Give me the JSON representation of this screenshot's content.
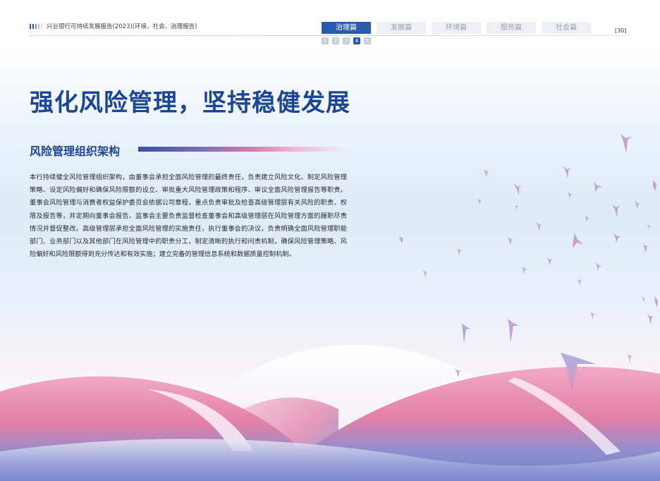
{
  "header": {
    "report_title": "兴业银行可持续发展报告(2023)(环境、社会、治理报告)",
    "bar_colors": [
      "#2a5ba8",
      "#2a5ba8",
      "#7a8cc4",
      "#b7c0dd",
      "#d8dcea"
    ],
    "page_number": "[30]"
  },
  "tabs": [
    {
      "label": "治理篇",
      "active": true
    },
    {
      "label": "发展篇",
      "active": false
    },
    {
      "label": "环境篇",
      "active": false
    },
    {
      "label": "服务篇",
      "active": false
    },
    {
      "label": "社会篇",
      "active": false
    }
  ],
  "steps": [
    {
      "label": "1",
      "active": false
    },
    {
      "label": "2",
      "active": false
    },
    {
      "label": "3",
      "active": false
    },
    {
      "label": "4",
      "active": true
    },
    {
      "label": "5",
      "active": false
    }
  ],
  "main": {
    "title": "强化风险管理，坚持稳健发展",
    "section_heading": "风险管理组织架构",
    "paragraph": "本行持续健全风险管理组织架构，由董事会承担全面风险管理的最终责任，负责建立风险文化、制定风险管理策略、设定风险偏好和确保风险限额的设立、审批重大风险管理政策和程序、审议全面风险管理报告等职责。董事会风险管理与消费者权益保护委员会依据公司章程，重点负责审批及检查高级管理层有关风险的职责、权限及报告等，并定期向董事会报告。监事会主要负责监督检查董事会和高级管理层在风险管理方面的履职尽责情况并督促整改。高级管理层承担全面风险管理的实施责任，执行董事会的决议，负责明确全面风险管理职能部门、业务部门以及其他部门在风险管理中的职责分工，制定清晰的执行和问责机制，确保风险管理策略、风险偏好和风险限额得到充分传达和有效实施；建立完备的管理信息系统和数据质量控制机制。"
  },
  "colors": {
    "brand_blue": "#1d4596",
    "tab_active": "#2a5ba8",
    "accent_pink": "#d97aa8"
  }
}
